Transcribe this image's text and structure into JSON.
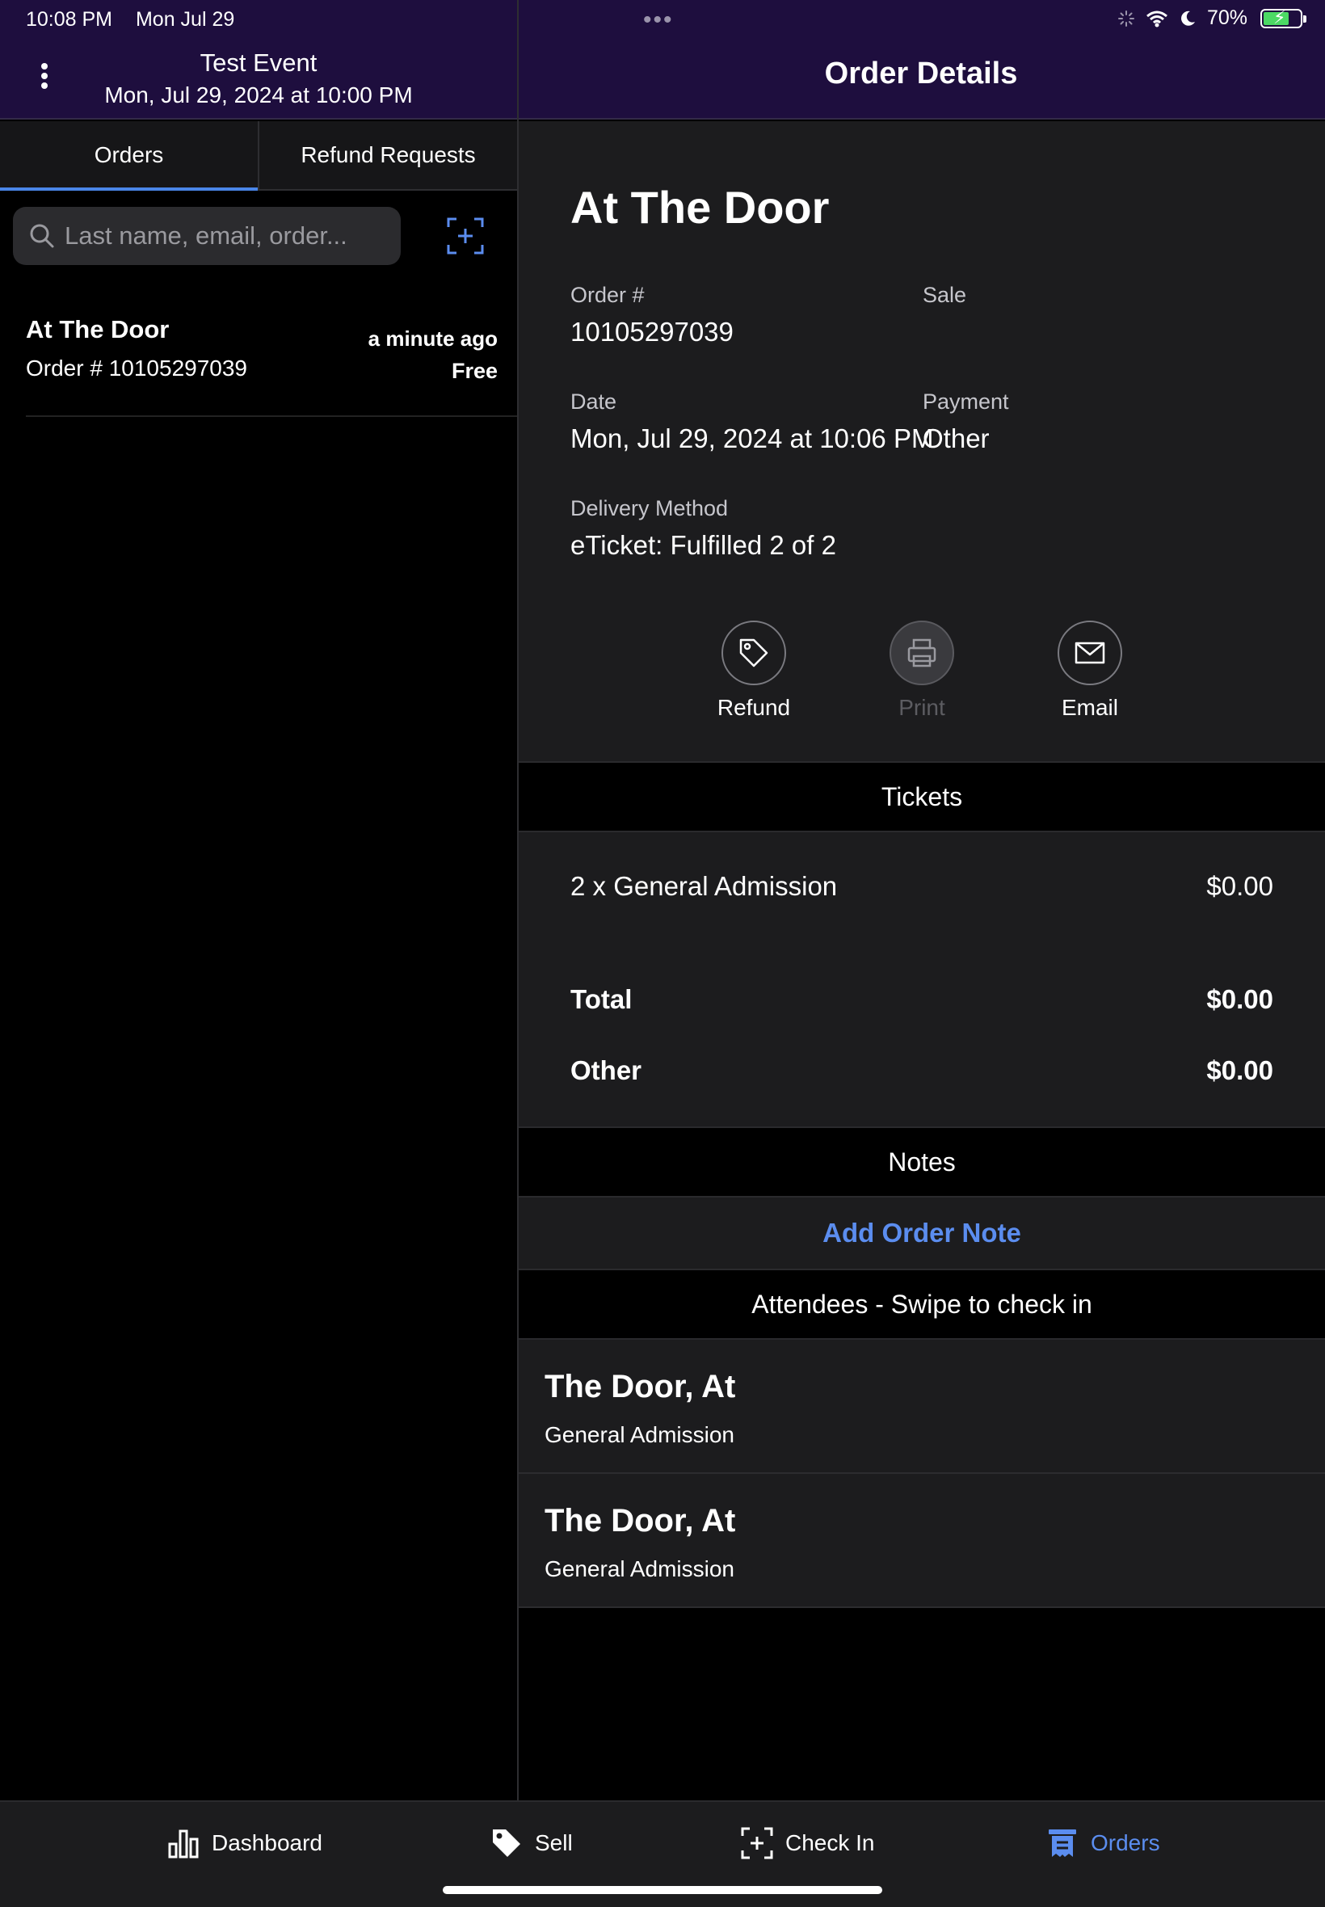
{
  "status_bar": {
    "time": "10:08 PM",
    "date": "Mon Jul 29",
    "dots": "•••",
    "battery": "70%",
    "battery_level": 0.7
  },
  "header": {
    "event_title": "Test Event",
    "event_date": "Mon, Jul 29, 2024 at 10:00 PM",
    "detail_title": "Order Details"
  },
  "tabs": [
    {
      "label": "Orders",
      "active": true
    },
    {
      "label": "Refund Requests",
      "active": false
    }
  ],
  "search": {
    "placeholder": "Last name, email, order..."
  },
  "orders": [
    {
      "name": "At The Door",
      "order": "Order # 10105297039",
      "time": "a minute ago",
      "price": "Free"
    }
  ],
  "detail": {
    "title": "At The Door",
    "order_label": "Order #",
    "order_value": "10105297039",
    "sale_label": "Sale",
    "date_label": "Date",
    "date_value": "Mon, Jul 29, 2024 at 10:06 PM",
    "payment_label": "Payment",
    "payment_value": "Other",
    "delivery_label": "Delivery Method",
    "delivery_value": "eTicket: Fulfilled 2 of 2",
    "actions": {
      "refund": "Refund",
      "print": "Print",
      "email": "Email"
    }
  },
  "tickets": {
    "heading": "Tickets",
    "line_label": "2 x General Admission",
    "line_value": "$0.00",
    "total_label": "Total",
    "total_value": "$0.00",
    "other_label": "Other",
    "other_value": "$0.00"
  },
  "notes": {
    "heading": "Notes",
    "add_label": "Add Order Note"
  },
  "attendees": {
    "heading": "Attendees - Swipe to check in",
    "items": [
      {
        "name": "The Door, At",
        "type": "General Admission"
      },
      {
        "name": "The Door, At",
        "type": "General Admission"
      }
    ]
  },
  "bottom_nav": [
    {
      "label": "Dashboard",
      "icon": "bar-chart-icon"
    },
    {
      "label": "Sell",
      "icon": "tag-icon"
    },
    {
      "label": "Check In",
      "icon": "scan-icon"
    },
    {
      "label": "Orders",
      "icon": "orders-icon",
      "active": true
    }
  ],
  "colors": {
    "header_bg": "#1e0e3e",
    "accent": "#5b8def",
    "panel": "#1c1c1e"
  }
}
